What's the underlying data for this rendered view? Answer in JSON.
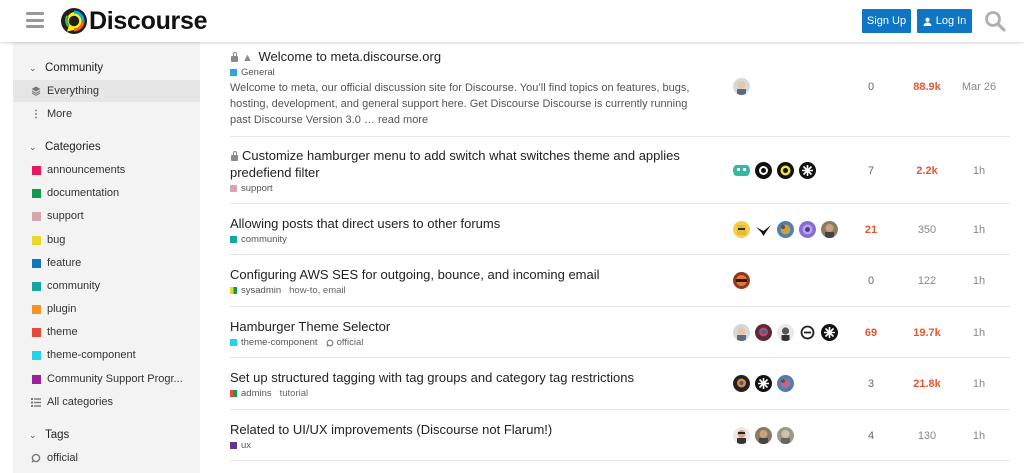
{
  "header": {
    "logo_text": "Discourse",
    "signup_label": "Sign Up",
    "login_label": "Log In"
  },
  "sidebar": {
    "community_heading": "Community",
    "community_items": [
      {
        "label": "Everything",
        "icon": "layers-icon"
      },
      {
        "label": "More",
        "icon": "ellipsis-vertical-icon"
      }
    ],
    "categories_heading": "Categories",
    "categories": [
      {
        "label": "announcements",
        "color": "#e9185a"
      },
      {
        "label": "documentation",
        "color": "#0e9b4e"
      },
      {
        "label": "support",
        "color": "#d5a5ab"
      },
      {
        "label": "bug",
        "color": "#e8d827"
      },
      {
        "label": "feature",
        "color": "#0e76bd"
      },
      {
        "label": "community",
        "color": "#12a89d"
      },
      {
        "label": "plugin",
        "color": "#f7941d"
      },
      {
        "label": "theme",
        "color": "#e74a3c"
      },
      {
        "label": "theme-component",
        "color": "#25d3e8"
      },
      {
        "label": "Community Support Progr...",
        "color": "#9e1f9c"
      }
    ],
    "all_categories_label": "All categories",
    "tags_heading": "Tags",
    "tags": [
      {
        "label": "official"
      }
    ]
  },
  "topics": [
    {
      "title": "Welcome to meta.discourse.org",
      "locked": true,
      "pinned": true,
      "category": "General",
      "category_color": "#2ea6d4",
      "tags": "",
      "excerpt": "Welcome to meta, our official discussion site for Discourse. You’ll find topics on features, bugs, hosting, development, and general support here. Get Discourse Discourse is currently running past Discourse Version 3.0 … read more",
      "replies": "0",
      "replies_hot": false,
      "views": "88.9k",
      "views_hot": true,
      "activity": "Mar 26"
    },
    {
      "title_line1": "Customize hamburger menu to add switch what switches theme and applies",
      "title_line2": "predefiend filter",
      "locked": true,
      "category": "support",
      "category_color": "#d5a5ab",
      "tags": "",
      "replies": "7",
      "replies_hot": false,
      "views": "2.2k",
      "views_hot": true,
      "activity": "1h"
    },
    {
      "title": "Allowing posts that direct users to other forums",
      "category": "community",
      "category_color": "#12a89d",
      "tags": "",
      "replies": "21",
      "replies_hot": true,
      "views": "350",
      "views_hot": false,
      "activity": "1h"
    },
    {
      "title": "Configuring AWS SES for outgoing, bounce, and incoming email",
      "category": "sysadmin",
      "category_color": "#e8d827",
      "tags": "how-to, email",
      "replies": "0",
      "replies_hot": false,
      "views": "122",
      "views_hot": false,
      "activity": "1h"
    },
    {
      "title": "Hamburger Theme Selector",
      "category": "theme-component",
      "category_color": "#25d3e8",
      "tags": "official",
      "replies": "69",
      "replies_hot": true,
      "views": "19.7k",
      "views_hot": true,
      "activity": "1h"
    },
    {
      "title": "Set up structured tagging with tag groups and category tag restrictions",
      "category": "admins",
      "category_color": "#e74a3c",
      "tags": "tutorial",
      "replies": "3",
      "replies_hot": false,
      "views": "21.8k",
      "views_hot": true,
      "activity": "1h"
    },
    {
      "title": "Related to UI/UX improvements (Discourse not Flarum!)",
      "category": "ux",
      "category_color": "#5b3a8c",
      "tags": "",
      "replies": "4",
      "replies_hot": false,
      "views": "130",
      "views_hot": false,
      "activity": "1h"
    }
  ]
}
